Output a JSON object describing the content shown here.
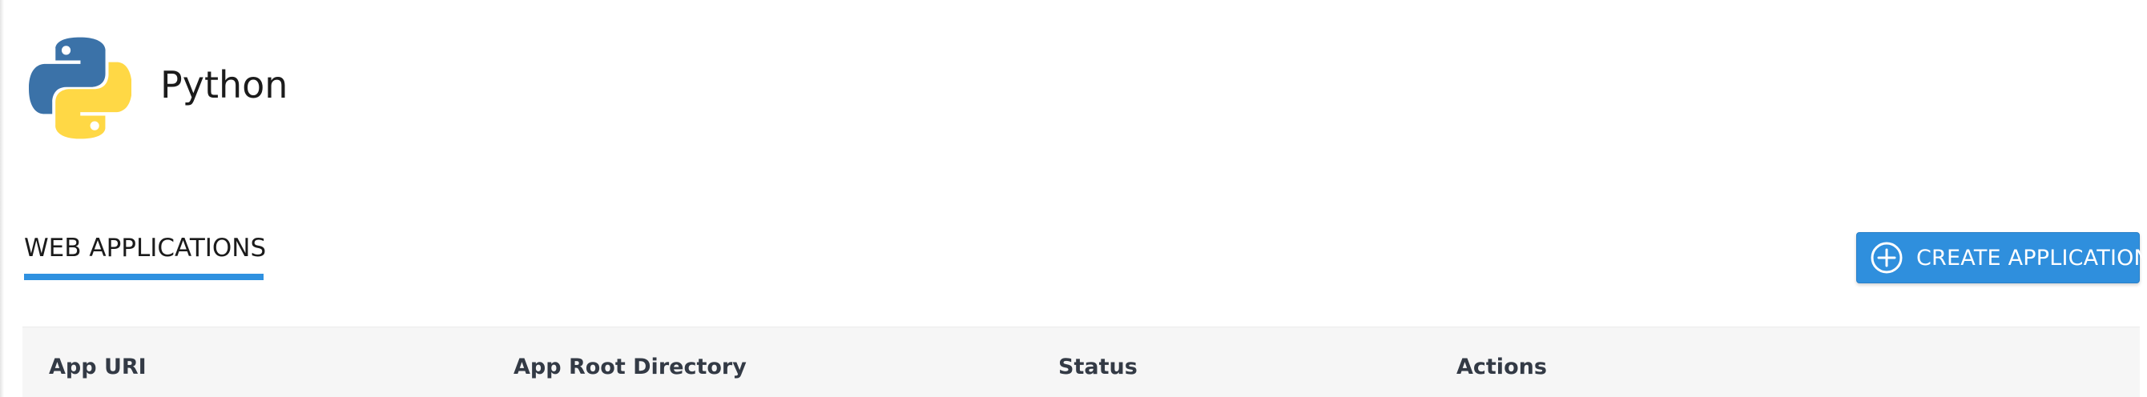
{
  "header": {
    "title": "Python",
    "logo_icon": "python-logo-icon"
  },
  "tabs": [
    {
      "label": "WEB APPLICATIONS",
      "active": true
    }
  ],
  "actions": {
    "create_label": "CREATE APPLICATION",
    "create_icon": "plus-circle-icon"
  },
  "table": {
    "columns": [
      "App URI",
      "App Root Directory",
      "Status",
      "Actions"
    ]
  },
  "colors": {
    "accent": "#2f91e0",
    "python_blue": "#3b72a8",
    "python_yellow": "#ffd845",
    "header_bg": "#f6f6f6",
    "header_text": "#333a45"
  }
}
